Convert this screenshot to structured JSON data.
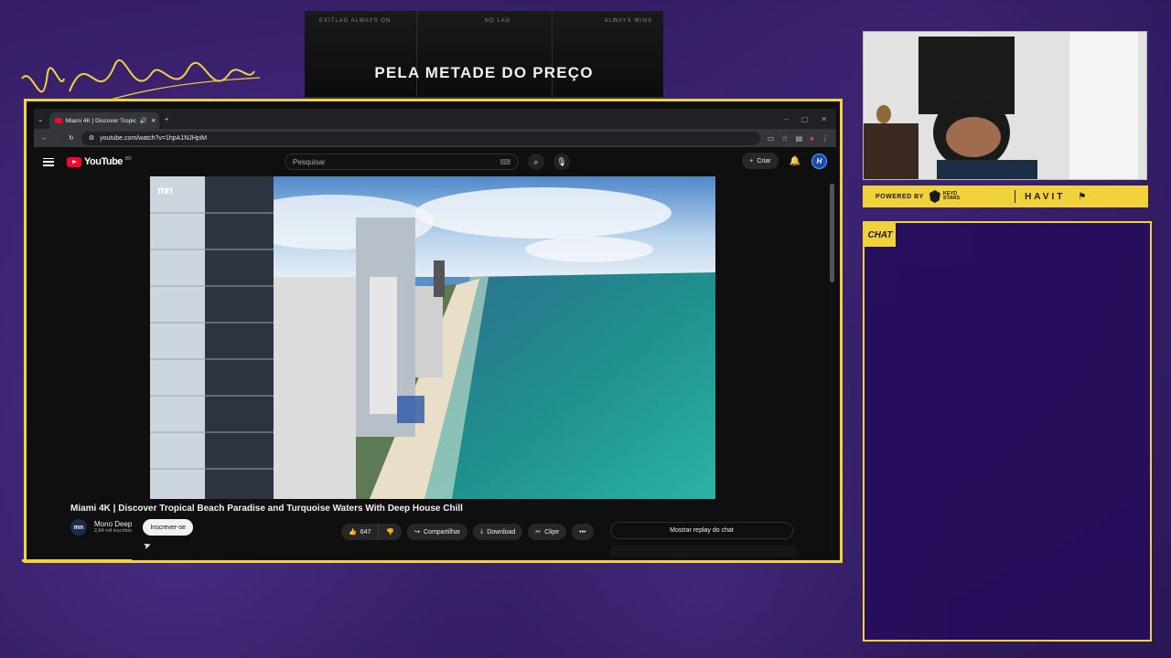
{
  "overlay": {
    "signature": "Vivo Keyd Stars",
    "ad": {
      "top_left": "EXITLAG ALWAYS ON",
      "top_center": "NO LAG",
      "top_right": "ALWAYS WINS",
      "headline": "PELA METADE DO PREÇO"
    },
    "sponsor": {
      "powered_label": "POWERED BY",
      "keyd_line1": "KEYD",
      "keyd_line2": "STARS",
      "havit": "HAVIT"
    },
    "chat_label": "CHAT"
  },
  "browser": {
    "tab_title": "Miami 4K | Discover Tropic",
    "new_tab": "+",
    "url": "youtube.com/watch?v=1hpA1NJHpiM",
    "win_min": "–",
    "win_max": "▢",
    "win_close": "✕"
  },
  "youtube": {
    "logo_text": "YouTube",
    "country": "BR",
    "search_placeholder": "Pesquisar",
    "create_label": "Criar",
    "avatar_letter": "H",
    "video_watermark": "mn",
    "video_title": "Miami 4K | Discover Tropical Beach Paradise and Turquoise Waters With Deep House Chill",
    "channel_name": "Mono Deep",
    "channel_initials": "mn",
    "subscribers": "2,84 mil inscritos",
    "subscribe_label": "Inscrever-se",
    "like_count": "647",
    "share_label": "Compartilhar",
    "download_label": "Download",
    "clip_label": "Clipe",
    "more_label": "•••",
    "chat_replay_label": "Mostrar replay do chat"
  },
  "colors": {
    "accent_yellow": "#f2d23a",
    "background_purple": "#37206a",
    "youtube_red": "#ff0033"
  }
}
